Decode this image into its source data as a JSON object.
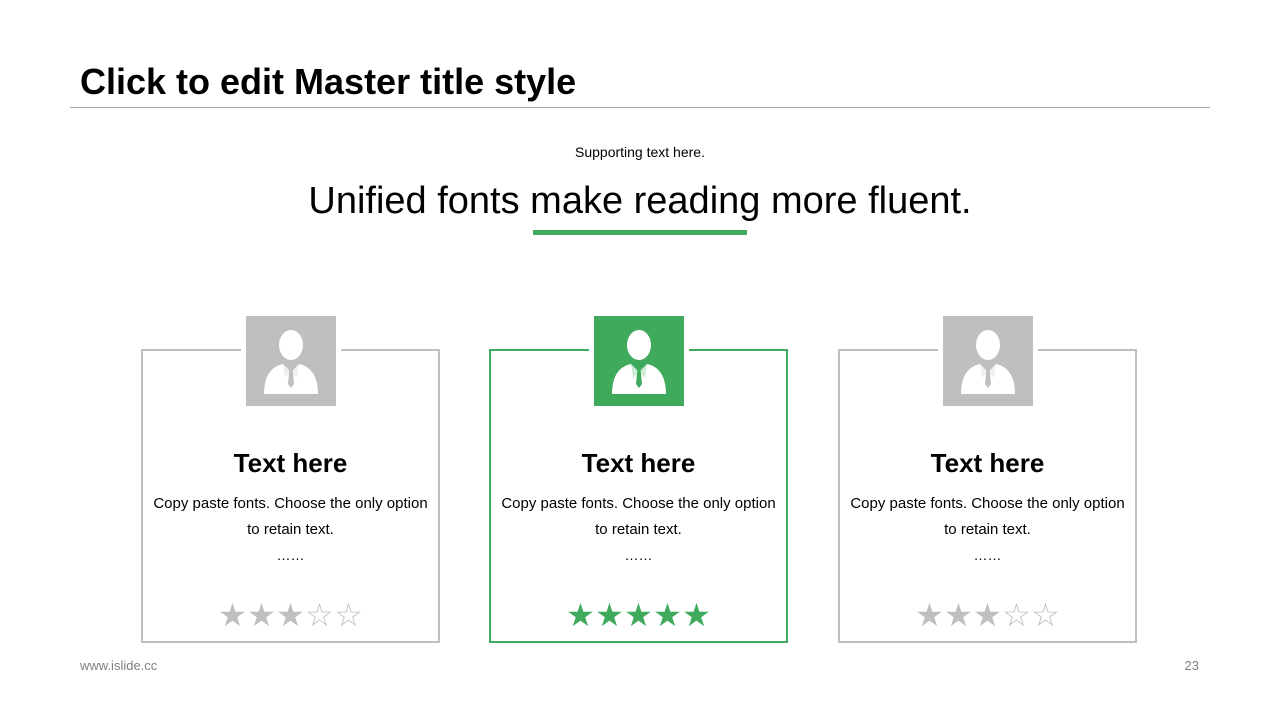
{
  "slide": {
    "title": "Click to edit Master title style",
    "supporting_text": "Supporting text here.",
    "headline": "Unified fonts make reading more fluent.",
    "footer_url": "www.islide.cc",
    "page_number": "23"
  },
  "colors": {
    "accent": "#3faa5b",
    "muted": "#bfbfbf",
    "rule": "#a6a6a6"
  },
  "cards": [
    {
      "title": "Text here",
      "text": "Copy paste fonts. Choose the only option to retain text.",
      "ellipsis": "……",
      "rating": 3,
      "max_rating": 5,
      "highlighted": false,
      "icon": "businessman-icon"
    },
    {
      "title": "Text here",
      "text": "Copy paste fonts. Choose the only option to retain text.",
      "ellipsis": "……",
      "rating": 5,
      "max_rating": 5,
      "highlighted": true,
      "icon": "businessman-icon"
    },
    {
      "title": "Text here",
      "text": "Copy paste fonts. Choose the only option to retain text.",
      "ellipsis": "……",
      "rating": 3,
      "max_rating": 5,
      "highlighted": false,
      "icon": "businessman-icon"
    }
  ]
}
